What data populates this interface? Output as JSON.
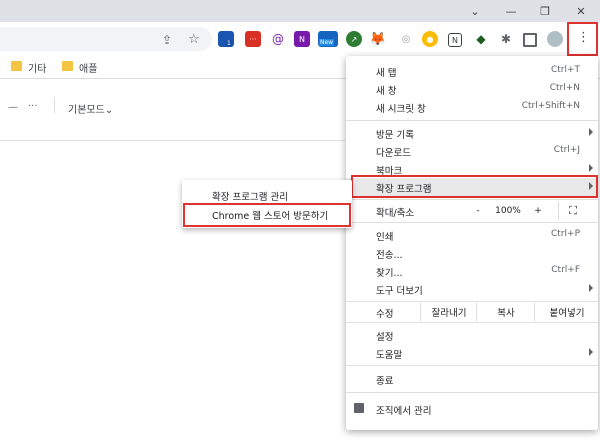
{
  "window": {
    "minimize": "—",
    "maximize": "❐",
    "close": "✕"
  },
  "bookmarks": [
    {
      "label": "기타"
    },
    {
      "label": "애플"
    }
  ],
  "page": {
    "dash": "—",
    "more": "···",
    "mode_label": "기본모드",
    "mode_chevron": "⌄"
  },
  "menu": {
    "new_tab": {
      "label": "새 탭",
      "shortcut": "Ctrl+T"
    },
    "new_window": {
      "label": "새 창",
      "shortcut": "Ctrl+N"
    },
    "new_incognito": {
      "label": "새 시크릿 창",
      "shortcut": "Ctrl+Shift+N"
    },
    "history": {
      "label": "방문 기록"
    },
    "downloads": {
      "label": "다운로드",
      "shortcut": "Ctrl+J"
    },
    "bookmarks": {
      "label": "북마크"
    },
    "extensions": {
      "label": "확장 프로그램"
    },
    "zoom": {
      "label": "확대/축소",
      "minus": "-",
      "value": "100%",
      "plus": "+",
      "fullscreen": "⛶"
    },
    "print": {
      "label": "인쇄",
      "shortcut": "Ctrl+P"
    },
    "cast": {
      "label": "전송..."
    },
    "find": {
      "label": "찾기...",
      "shortcut": "Ctrl+F"
    },
    "more_tools": {
      "label": "도구 더보기"
    },
    "edit": {
      "label": "수정",
      "cut": "잘라내기",
      "copy": "복사",
      "paste": "붙여넣기"
    },
    "settings": {
      "label": "설정"
    },
    "help": {
      "label": "도움말"
    },
    "exit": {
      "label": "종료"
    },
    "managed": {
      "label": "조직에서 관리"
    }
  },
  "submenu": {
    "manage": "확장 프로그램 관리",
    "webstore": "Chrome 웹 스토어 방문하기"
  },
  "toolbar": {
    "share_icon": "⇪",
    "star_icon": "☆",
    "ext_new_badge": "New",
    "ext_n_label": "N",
    "ext_1_badge": "1",
    "menu_dots": "⋮"
  },
  "colors": {
    "highlight": "#e03131",
    "menu_hover": "#e8e8e8"
  }
}
